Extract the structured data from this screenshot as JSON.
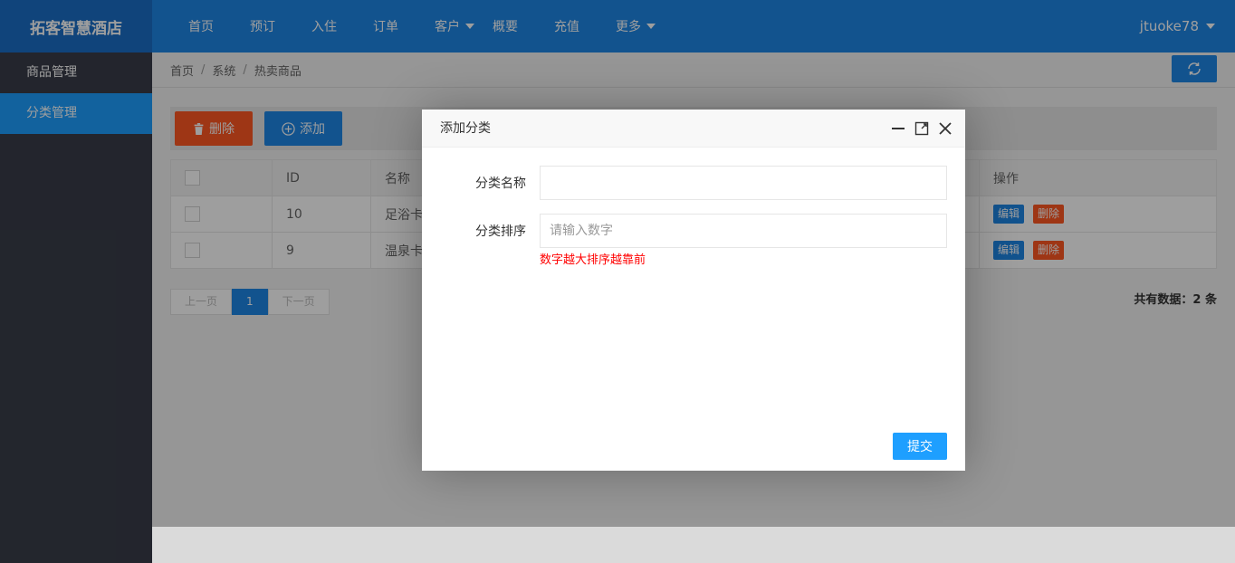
{
  "app": {
    "title": "拓客智慧酒店"
  },
  "topnav": {
    "items": [
      {
        "label": "首页"
      },
      {
        "label": "预订"
      },
      {
        "label": "入住"
      },
      {
        "label": "订单"
      },
      {
        "label": "客户",
        "dropdown": true
      },
      {
        "label": "概要"
      },
      {
        "label": "充值"
      },
      {
        "label": "更多",
        "dropdown": true
      }
    ],
    "user": "jtuoke78"
  },
  "sidebar": {
    "items": [
      {
        "label": "商品管理",
        "active": false
      },
      {
        "label": "分类管理",
        "active": true
      }
    ]
  },
  "breadcrumb": [
    "首页",
    "系统",
    "热卖商品"
  ],
  "toolbar": {
    "delete_label": "删除",
    "add_label": "添加"
  },
  "table": {
    "headers": [
      "ID",
      "名称",
      "操作"
    ],
    "rows": [
      {
        "id": "10",
        "name": "足浴卡",
        "edit": "编辑",
        "delete": "删除"
      },
      {
        "id": "9",
        "name": "温泉卡",
        "edit": "编辑",
        "delete": "删除"
      }
    ]
  },
  "pager": {
    "prev": "上一页",
    "current": "1",
    "next": "下一页",
    "total": "共有数据：2 条"
  },
  "dialog": {
    "title": "添加分类",
    "name_label": "分类名称",
    "name_value": "",
    "sort_label": "分类排序",
    "sort_placeholder": "请输入数字",
    "hint": "数字越大排序越靠前",
    "submit_label": "提交"
  },
  "colors": {
    "primary": "#1e86e6",
    "danger": "#ff5722",
    "sidebar": "#393d49",
    "active": "#1e9fff"
  }
}
